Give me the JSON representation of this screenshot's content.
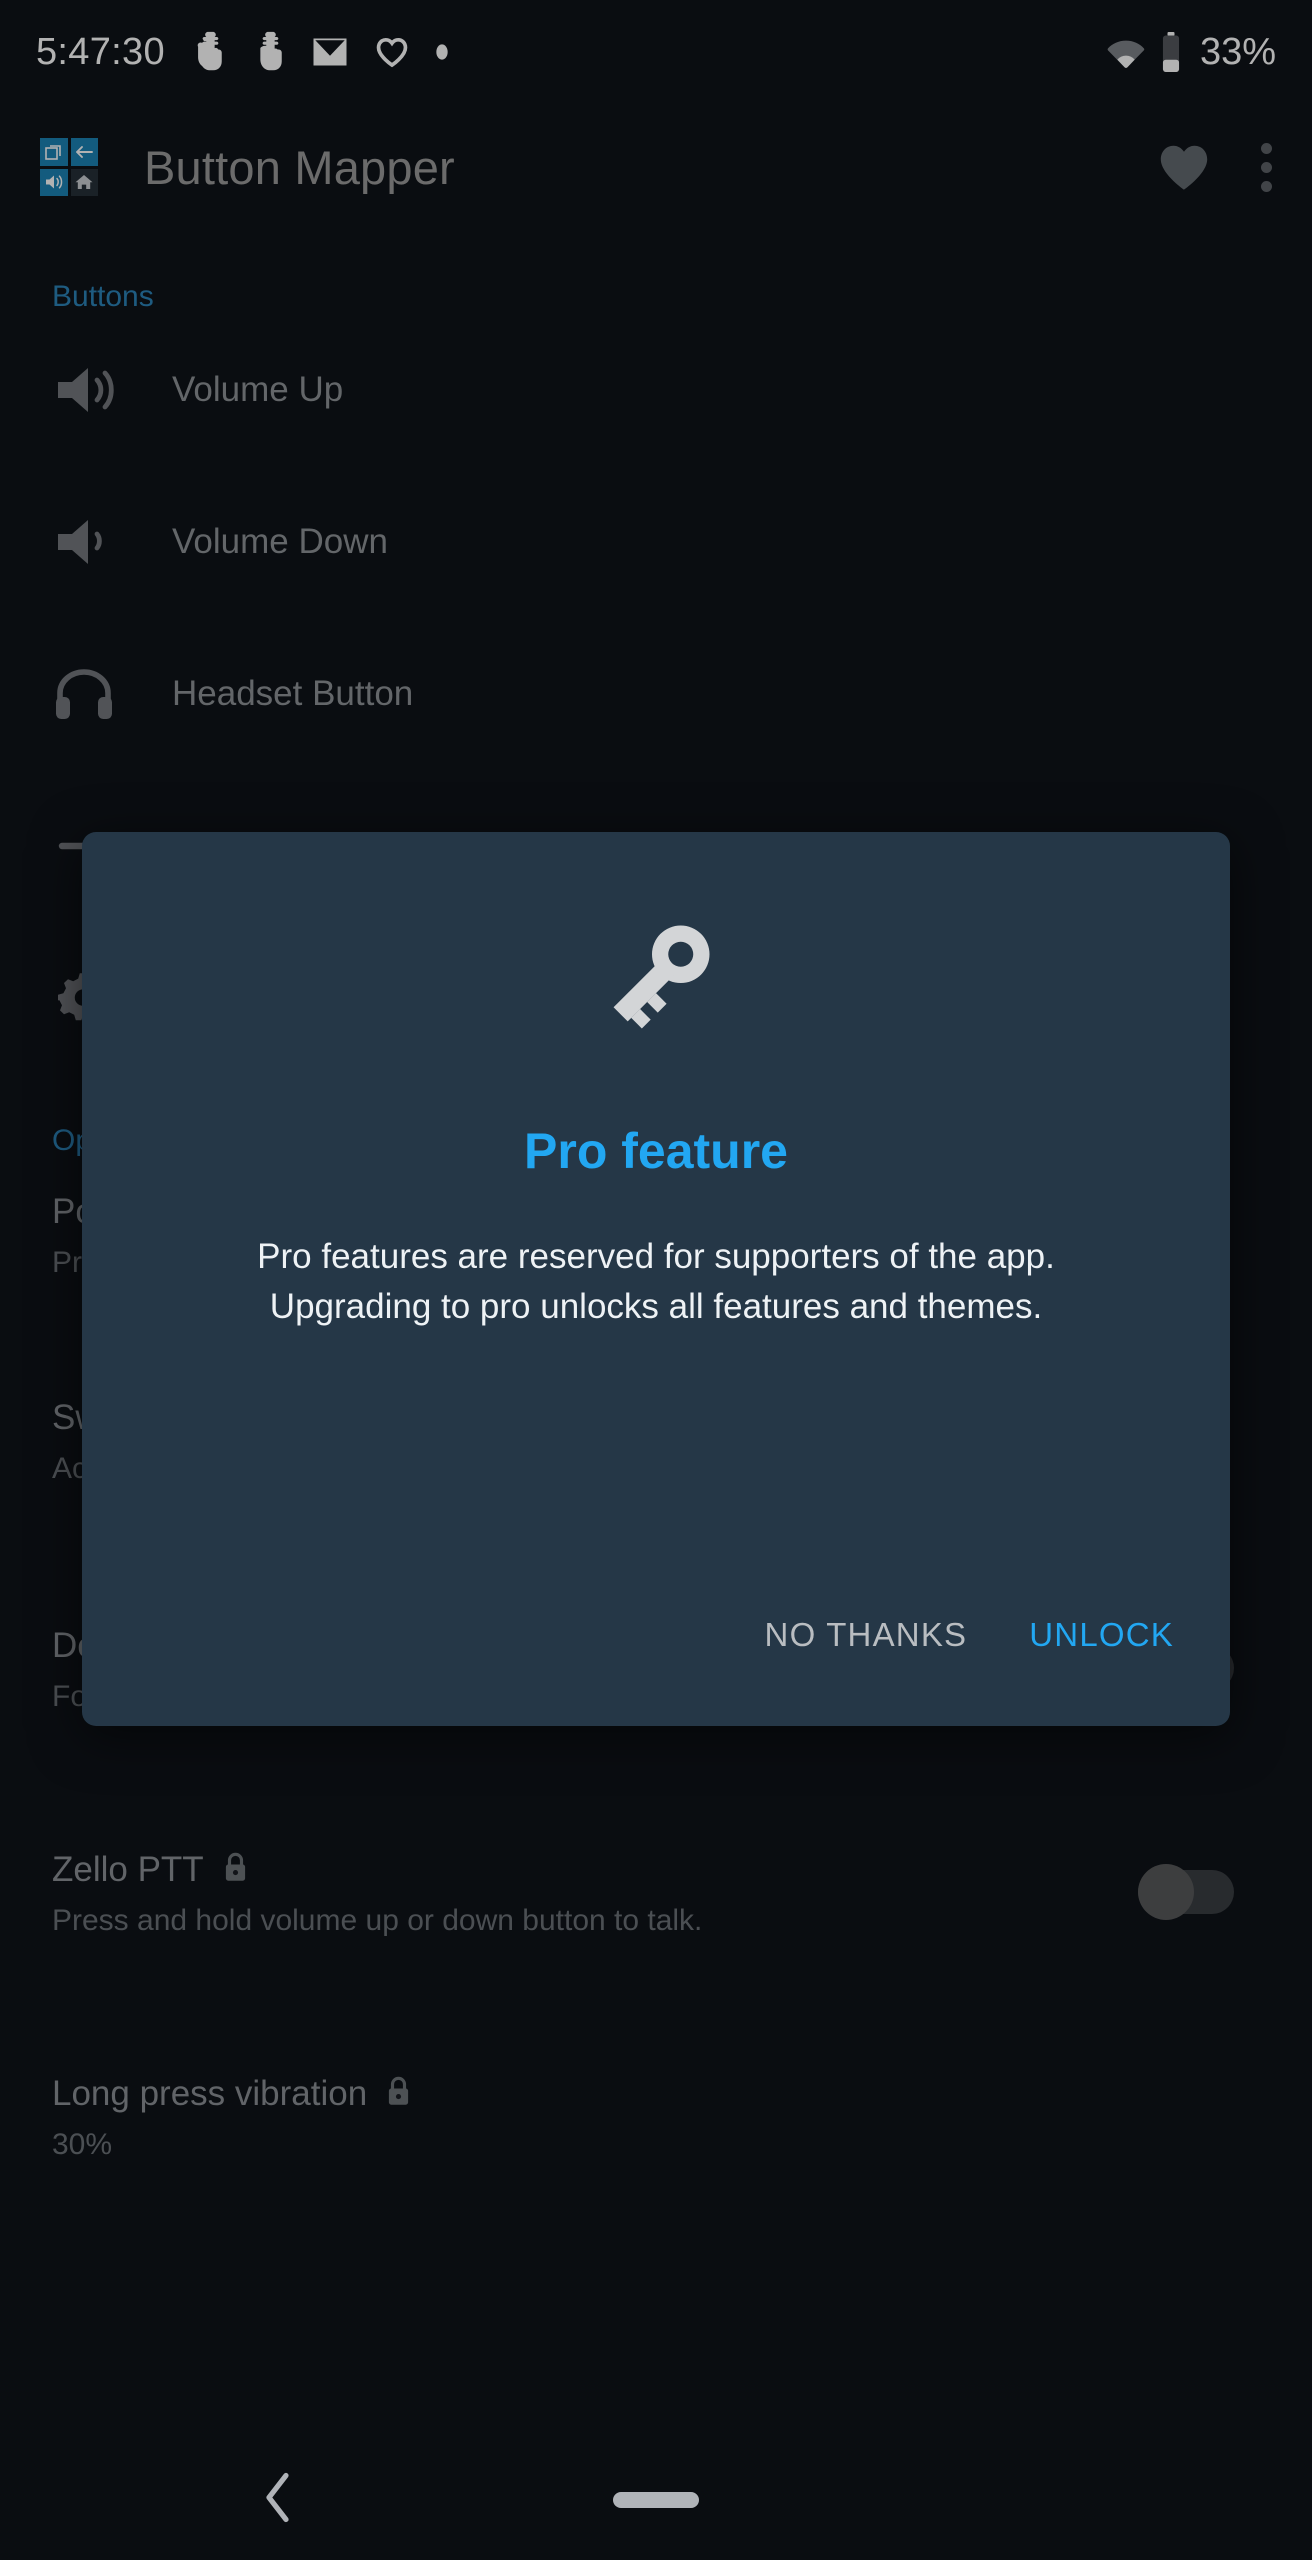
{
  "statusbar": {
    "clock": "5:47:30",
    "battery_percent": "33%",
    "icons": [
      "gesture-hand-icon",
      "gesture-hand-icon",
      "email-icon",
      "heart-outline-icon",
      "dot-icon"
    ],
    "right_icons": [
      "wifi-icon",
      "battery-icon"
    ]
  },
  "appbar": {
    "title": "Button Mapper",
    "logo_name": "button-mapper-logo",
    "favorite_icon": "heart-filled-icon",
    "overflow_icon": "more-vertical-icon"
  },
  "sections": {
    "buttons": {
      "header": "Buttons",
      "items": [
        {
          "label": "Volume Up",
          "icon": "volume-up-icon"
        },
        {
          "label": "Volume Down",
          "icon": "volume-down-icon"
        },
        {
          "label": "Headset Button",
          "icon": "headset-icon"
        },
        {
          "label": "",
          "icon": "add-button-icon"
        },
        {
          "label": "",
          "icon": "gear-icon"
        }
      ]
    },
    "options": {
      "header": "Options",
      "items": [
        {
          "title": "Power button",
          "subtitle": "Press",
          "truncated": true,
          "has_toggle": false
        },
        {
          "title": "Switch",
          "subtitle": "Ac",
          "truncated": true,
          "has_toggle": false
        },
        {
          "title": "Default to ring volume",
          "subtitle": "Force volume buttons to control ringer volume",
          "lock_icon": "lock-icon",
          "has_toggle": true,
          "toggle_state": "off"
        },
        {
          "title": "Zello PTT",
          "subtitle": "Press and hold volume up or down button to talk.",
          "lock_icon": "lock-icon",
          "has_toggle": true,
          "toggle_state": "off"
        },
        {
          "title": "Long press vibration",
          "subtitle": "30%",
          "lock_icon": "lock-icon",
          "has_toggle": false
        }
      ]
    }
  },
  "dialog": {
    "icon": "key-icon",
    "title": "Pro feature",
    "body_line1": "Pro features are reserved for supporters of the app.",
    "body_line2": "Upgrading to pro unlocks all features and themes.",
    "buttons": {
      "decline": "NO THANKS",
      "confirm": "UNLOCK"
    }
  },
  "navbar": {
    "back_icon": "back-chevron-icon",
    "home_pill": "gesture-home-pill"
  },
  "colors": {
    "background": "#0f1319",
    "dialog_background": "#253747",
    "accent_blue": "#22a7f2",
    "section_header_blue": "#2c83b8",
    "primary_text": "#8e9297",
    "secondary_text": "#6c7177"
  }
}
